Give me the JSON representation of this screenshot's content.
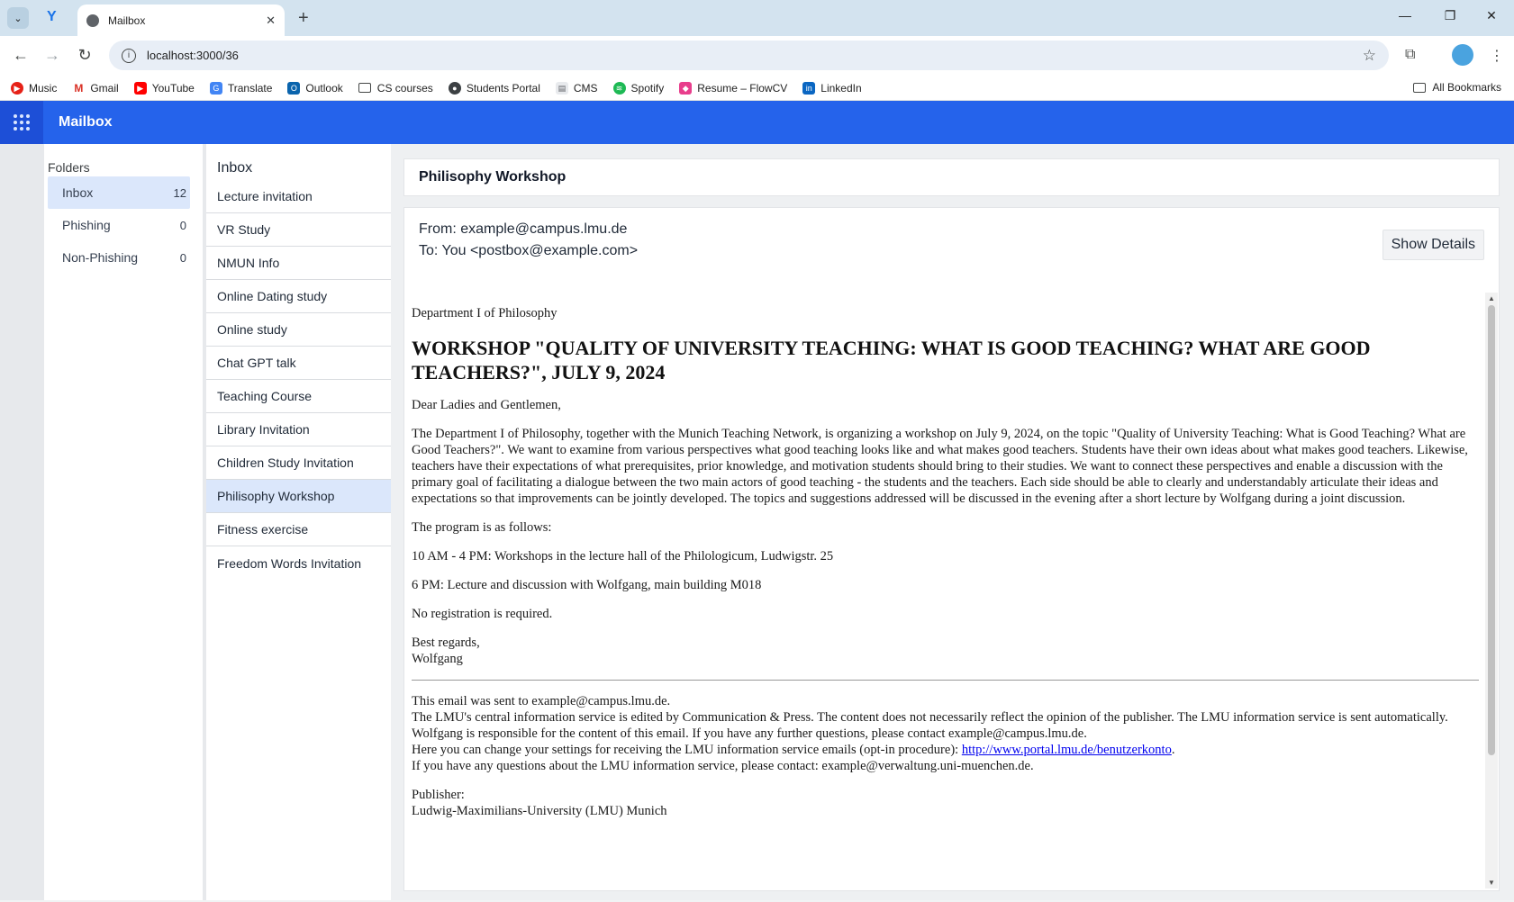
{
  "browser": {
    "tab_title": "Mailbox",
    "url": "localhost:3000/36",
    "bookmarks": [
      "Music",
      "Gmail",
      "YouTube",
      "Translate",
      "Outlook",
      "CS courses",
      "Students Portal",
      "CMS",
      "Spotify",
      "Resume – FlowCV",
      "LinkedIn"
    ],
    "all_bookmarks_label": "All Bookmarks"
  },
  "app": {
    "title": "Mailbox"
  },
  "folders": {
    "title": "Folders",
    "items": [
      {
        "name": "Inbox",
        "count": "12"
      },
      {
        "name": "Phishing",
        "count": "0"
      },
      {
        "name": "Non-Phishing",
        "count": "0"
      }
    ]
  },
  "inbox": {
    "title": "Inbox",
    "mails": [
      "Lecture invitation",
      "VR Study",
      "NMUN Info",
      "Online Dating study",
      "Online study",
      "Chat GPT talk",
      "Teaching Course",
      "Library Invitation",
      "Children Study Invitation",
      "Philisophy Workshop",
      "Fitness exercise",
      "Freedom Words Invitation"
    ]
  },
  "message": {
    "subject": "Philisophy Workshop",
    "from": "From: example@campus.lmu.de",
    "to": "To: You <postbox@example.com>",
    "show_details_label": "Show Details",
    "department": "Department I of Philosophy",
    "heading": "WORKSHOP \"QUALITY OF UNIVERSITY TEACHING: WHAT IS GOOD TEACHING? WHAT ARE GOOD TEACHERS?\", JULY 9, 2024",
    "greeting": "Dear Ladies and Gentlemen,",
    "body": "The Department I of Philosophy, together with the Munich Teaching Network, is organizing a workshop on July 9, 2024, on the topic \"Quality of University Teaching: What is Good Teaching? What are Good Teachers?\". We want to examine from various perspectives what good teaching looks like and what makes good teachers. Students have their own ideas about what makes good teachers. Likewise, teachers have their expectations of what prerequisites, prior knowledge, and motivation students should bring to their studies. We want to connect these perspectives and enable a discussion with the primary goal of facilitating a dialogue between the two main actors of good teaching - the students and the teachers. Each side should be able to clearly and understandably articulate their ideas and expectations so that improvements can be jointly developed. The topics and suggestions addressed will be discussed in the evening after a short lecture by Wolfgang during a joint discussion.",
    "program_intro": "The program is as follows:",
    "program_1": "10 AM - 4 PM: Workshops in the lecture hall of the Philologicum, Ludwigstr. 25",
    "program_2": "6 PM: Lecture and discussion with Wolfgang, main building M018",
    "registration": "No registration is required.",
    "closing": "Best regards,",
    "signature": "Wolfgang",
    "footer_1": "This email was sent to example@campus.lmu.de.",
    "footer_2": "The LMU's central information service is edited by Communication & Press. The content does not necessarily reflect the opinion of the publisher. The LMU information service is sent automatically.",
    "footer_3": "Wolfgang is responsible for the content of this email. If you have any further questions, please contact example@campus.lmu.de.",
    "footer_4_prefix": "Here you can change your settings for receiving the LMU information service emails (opt-in procedure): ",
    "footer_4_link": "http://www.portal.lmu.de/benutzerkonto",
    "footer_4_suffix": ".",
    "footer_5": "If you have any questions about the LMU information service, please contact: example@verwaltung.uni-muenchen.de.",
    "publisher_label": "Publisher:",
    "publisher_name": "Ludwig-Maximilians-University (LMU) Munich"
  },
  "colors": {
    "header": "#2563eb",
    "selected": "#dbe7fb"
  }
}
